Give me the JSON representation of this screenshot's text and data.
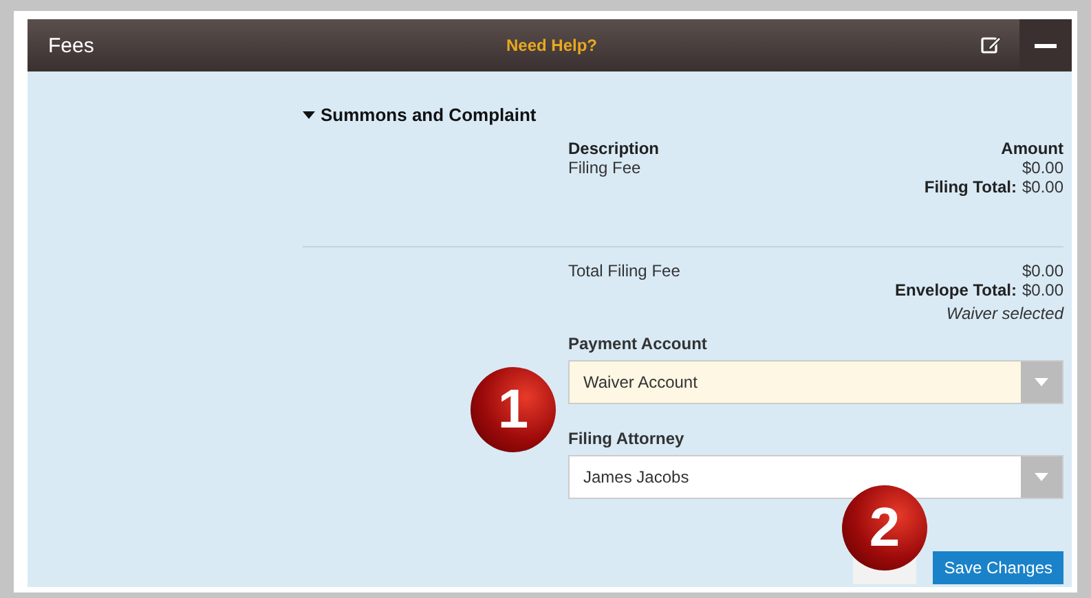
{
  "panel": {
    "title": "Fees",
    "help_link": "Need Help?"
  },
  "section": {
    "title": "Summons and Complaint",
    "expanded": true
  },
  "fees": {
    "columns": [
      "Description",
      "Amount"
    ],
    "rows": [
      {
        "description": "Filing Fee",
        "amount": "$0.00"
      }
    ],
    "total_label": "Filing Total:",
    "total": "$0.00"
  },
  "summary": {
    "rows": [
      {
        "label": "Total Filing Fee",
        "amount": "$0.00"
      }
    ],
    "total_label": "Envelope Total:",
    "total": "$0.00",
    "note": "Waiver selected"
  },
  "fields": [
    {
      "label": "Payment Account",
      "value": "Waiver Account",
      "highlighted": true
    },
    {
      "label": "Filing Attorney",
      "value": "James Jacobs",
      "highlighted": false
    }
  ],
  "buttons": [
    {
      "kind": "covered"
    },
    {
      "kind": "primary",
      "label": "Save Changes"
    }
  ],
  "callouts": [
    "1",
    "2"
  ]
}
